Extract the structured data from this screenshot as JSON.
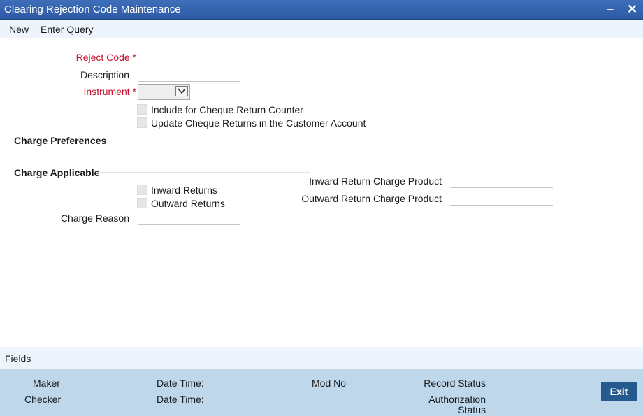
{
  "window": {
    "title": "Clearing Rejection Code Maintenance",
    "minimize_icon": "minimize-icon",
    "close_icon": "close-icon"
  },
  "menu": {
    "new": "New",
    "enter_query": "Enter Query"
  },
  "form": {
    "reject_code": {
      "label": "Reject Code",
      "required_mark": "*",
      "value": ""
    },
    "description": {
      "label": "Description",
      "value": ""
    },
    "instrument": {
      "label": "Instrument",
      "required_mark": "*",
      "value": ""
    },
    "include_cheque_return_counter": {
      "label": "Include for Cheque Return Counter",
      "checked": false
    },
    "update_cheque_returns": {
      "label": "Update Cheque Returns in the Customer Account",
      "checked": false
    }
  },
  "sections": {
    "charge_preferences": "Charge Preferences",
    "charge_applicable": "Charge Applicable"
  },
  "charges": {
    "inward_returns": {
      "label": "Inward Returns",
      "checked": false
    },
    "outward_returns": {
      "label": "Outward Returns",
      "checked": false
    },
    "charge_reason": {
      "label": "Charge Reason",
      "value": ""
    },
    "inward_return_charge_product": {
      "label": "Inward Return Charge Product",
      "value": ""
    },
    "outward_return_charge_product": {
      "label": "Outward Return Charge Product",
      "value": ""
    }
  },
  "fields_bar": {
    "label": "Fields"
  },
  "footer": {
    "maker": "Maker",
    "checker": "Checker",
    "date_time_1": "Date Time:",
    "date_time_2": "Date Time:",
    "mod_no": "Mod No",
    "record_status": "Record Status",
    "authorization_status_line1": "Authorization",
    "authorization_status_line2": "Status",
    "exit": "Exit"
  },
  "colors": {
    "titlebar": "#2d5aa3",
    "required_label": "#c8102e",
    "footer_bg": "#bfd7eb",
    "exit_button": "#255a8e"
  }
}
